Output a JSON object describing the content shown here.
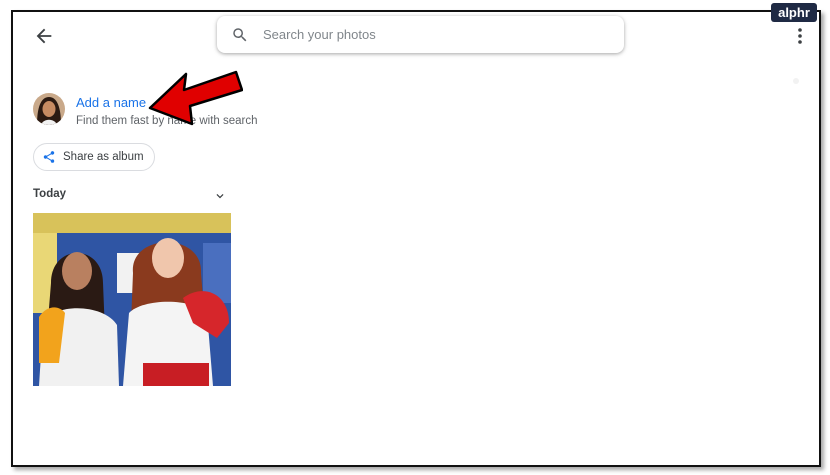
{
  "brand": {
    "logo_text": "alphr"
  },
  "toolbar": {
    "back_icon": "arrow-left-icon",
    "more_icon": "more-vert-icon"
  },
  "search": {
    "placeholder": "Search your photos",
    "icon": "search-icon"
  },
  "person": {
    "add_name_label": "Add a name",
    "hint": "Find them fast by name with search"
  },
  "share": {
    "label": "Share as album",
    "icon": "share-icon"
  },
  "section": {
    "title": "Today",
    "chevron_icon": "chevron-down-icon"
  },
  "colors": {
    "accent": "#1a73e8",
    "annotation_arrow": "#e00000",
    "logo_bg": "#1f2a44"
  }
}
